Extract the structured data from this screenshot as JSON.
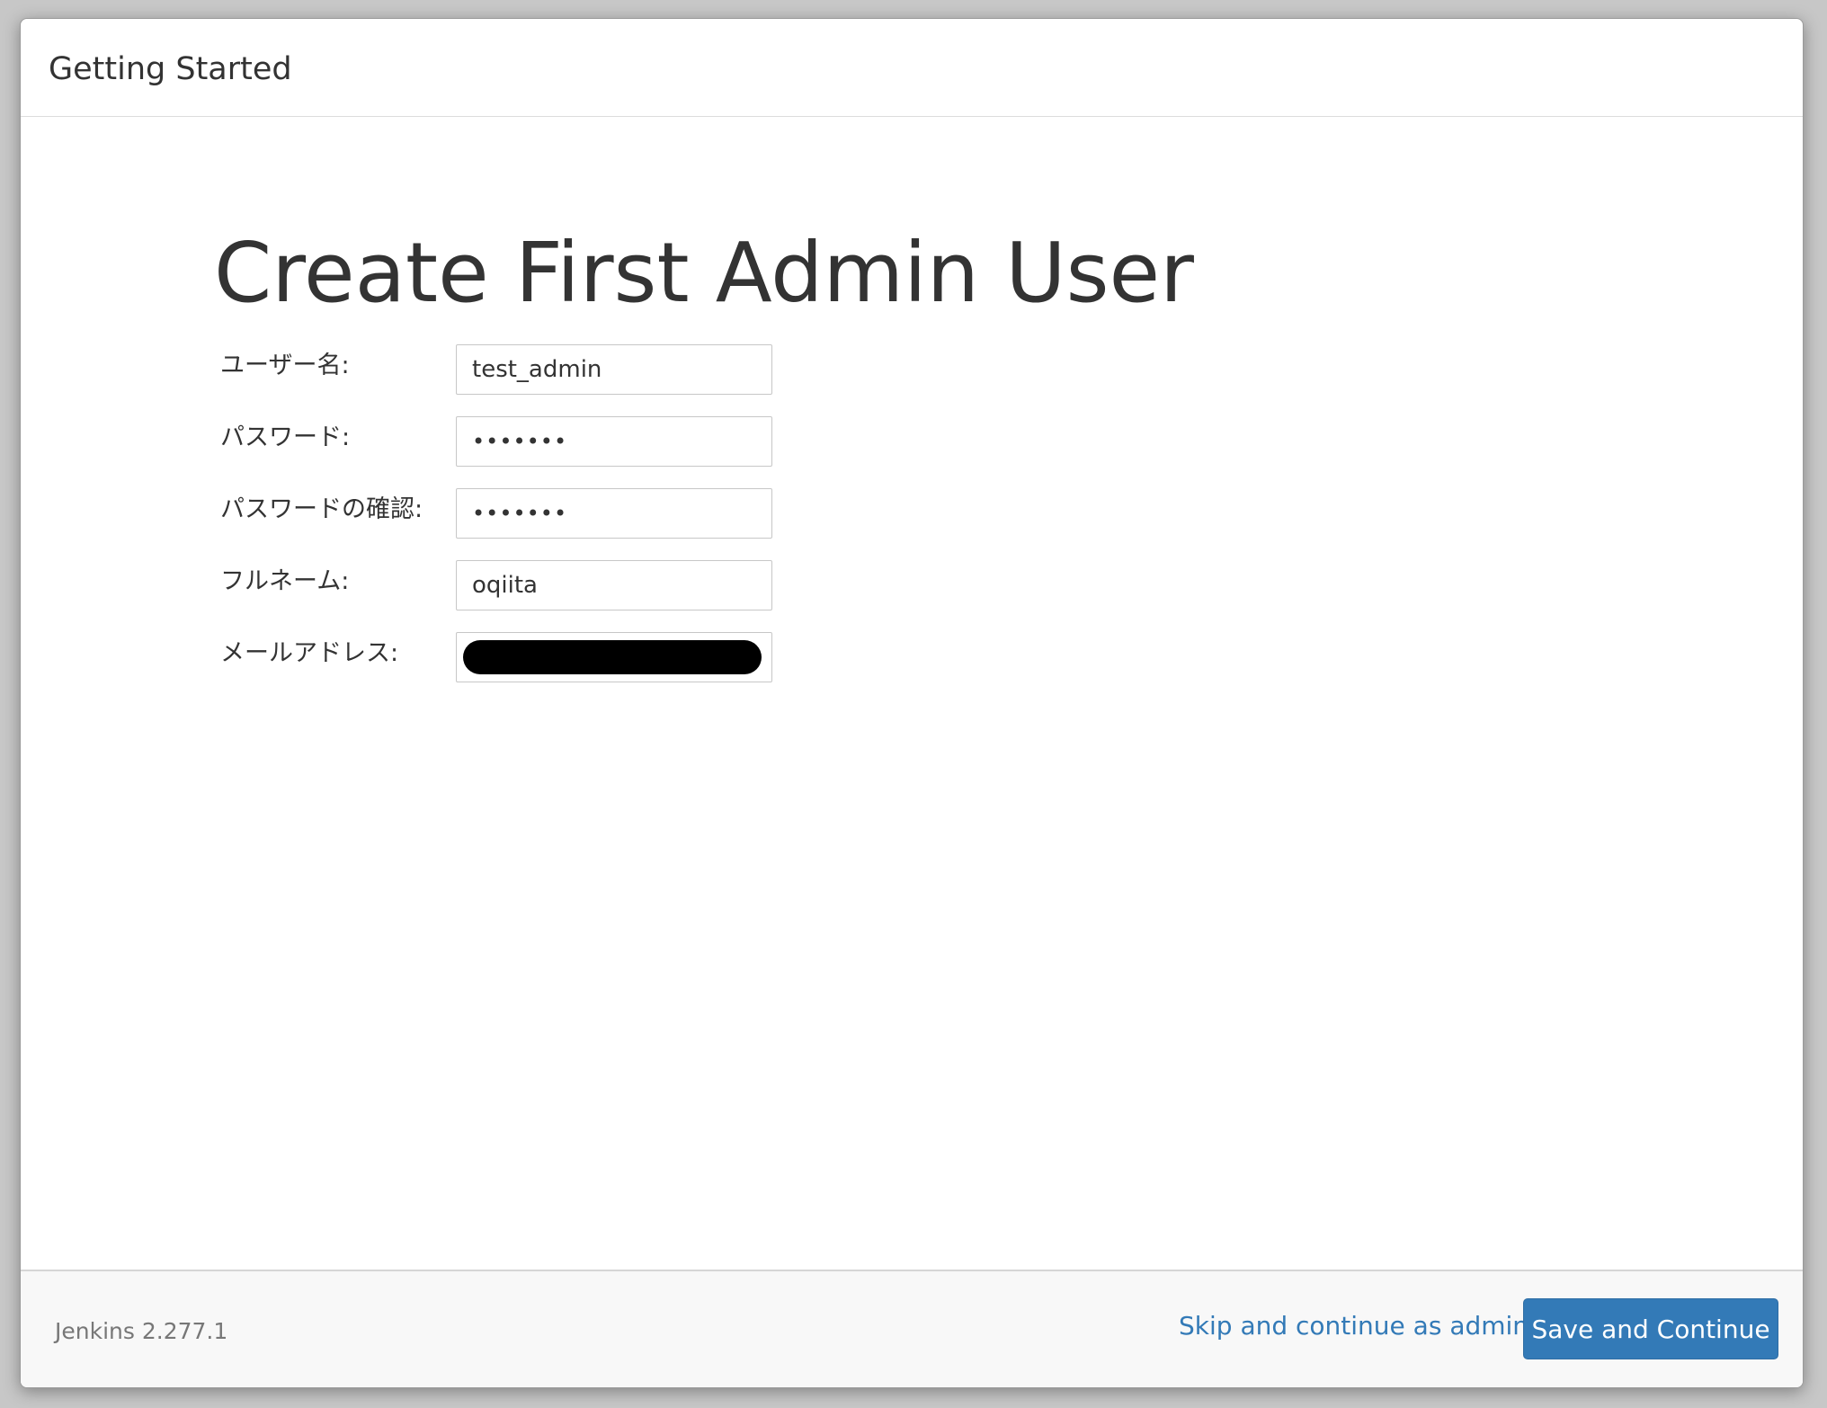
{
  "dialog": {
    "title": "Getting Started"
  },
  "page": {
    "heading": "Create First Admin User"
  },
  "form": {
    "username": {
      "label": "ユーザー名:",
      "value": "test_admin"
    },
    "password": {
      "label": "パスワード:",
      "value": "•••••••"
    },
    "password_confirm": {
      "label": "パスワードの確認:",
      "value": "•••••••"
    },
    "fullname": {
      "label": "フルネーム:",
      "value": "oqiita"
    },
    "email": {
      "label": "メールアドレス:",
      "value": ""
    }
  },
  "footer": {
    "version": "Jenkins 2.277.1",
    "skip_label": "Skip and continue as admin",
    "save_label": "Save and Continue"
  },
  "colors": {
    "primary_button": "#337ab7",
    "link": "#337ab7",
    "text": "#333333",
    "muted_text": "#777777"
  }
}
